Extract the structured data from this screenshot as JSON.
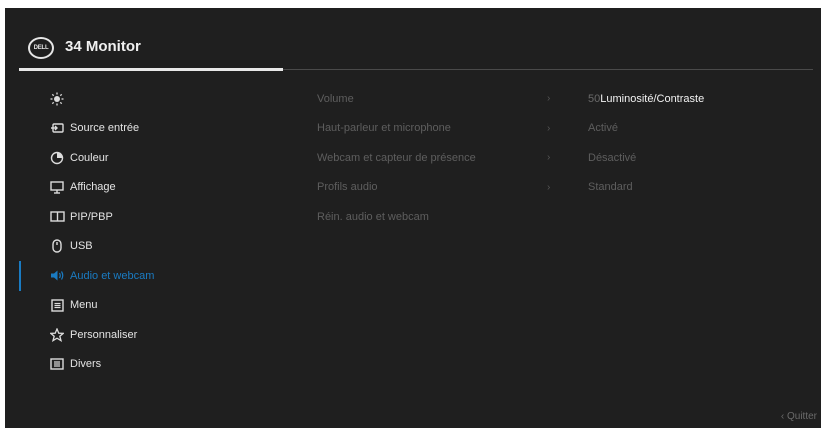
{
  "header": {
    "logo_text": "DELL",
    "title": "34 Monitor"
  },
  "sidebar": {
    "items": [
      {
        "label": "",
        "icon": "brightness-icon"
      },
      {
        "label": "Source entrée",
        "icon": "input-source-icon"
      },
      {
        "label": "Couleur",
        "icon": "color-icon"
      },
      {
        "label": "Affichage",
        "icon": "display-icon"
      },
      {
        "label": "PIP/PBP",
        "icon": "pip-icon"
      },
      {
        "label": "USB",
        "icon": "usb-icon"
      },
      {
        "label": "Audio et webcam",
        "icon": "speaker-icon",
        "active": true
      },
      {
        "label": "Menu",
        "icon": "menu-icon"
      },
      {
        "label": "Personnaliser",
        "icon": "star-icon"
      },
      {
        "label": "Divers",
        "icon": "others-icon"
      }
    ]
  },
  "submenu": {
    "items": [
      {
        "label": "Volume",
        "chevron": "›"
      },
      {
        "label": "Haut-parleur et microphone",
        "chevron": "›"
      },
      {
        "label": "Webcam et capteur de présence",
        "chevron": "›"
      },
      {
        "label": "Profils audio",
        "chevron": "›"
      },
      {
        "label": "Réin. audio et webcam"
      }
    ]
  },
  "values": {
    "volume_number": "50",
    "volume_text": "Luminosité/Contraste",
    "speaker_mic": "Activé",
    "webcam": "Désactivé",
    "audio_profile": "Standard"
  },
  "footer": {
    "quit_label": "Quitter",
    "quit_chevron": "‹"
  },
  "colors": {
    "background": "#1f1f1f",
    "accent": "#1a7bc2"
  }
}
